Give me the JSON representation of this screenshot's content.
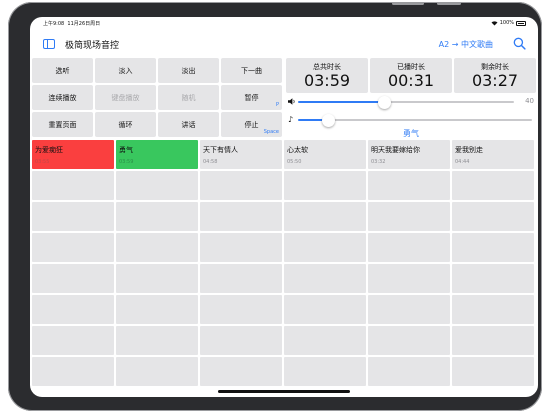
{
  "status": {
    "time": "上午9:08",
    "date": "11月26日周日",
    "battery": "100%"
  },
  "header": {
    "title": "极简现场音控",
    "playlist": "A2 → 中文歌曲"
  },
  "controls": [
    {
      "label": "选听"
    },
    {
      "label": "淡入"
    },
    {
      "label": "淡出"
    },
    {
      "label": "下一曲"
    },
    {
      "label": "连续播放"
    },
    {
      "label": "键盘播放",
      "disabled": true
    },
    {
      "label": "随机",
      "disabled": true
    },
    {
      "label": "暂停",
      "hotkey": "P"
    },
    {
      "label": "重置页面"
    },
    {
      "label": "循环"
    },
    {
      "label": "讲话"
    },
    {
      "label": "停止",
      "hotkey": "Space"
    }
  ],
  "timers": [
    {
      "label": "总共时长",
      "value": "03:59"
    },
    {
      "label": "已播时长",
      "value": "00:31"
    },
    {
      "label": "剩余时长",
      "value": "03:27"
    }
  ],
  "volume": {
    "value": "40",
    "level": 0.4
  },
  "progress": {
    "fraction": 0.13
  },
  "now_playing": "勇气",
  "tracks": [
    {
      "title": "为爱痴狂",
      "duration": "03:55",
      "state": "red"
    },
    {
      "title": "勇气",
      "duration": "03:59",
      "state": "green"
    },
    {
      "title": "天下有情人",
      "duration": "04:58"
    },
    {
      "title": "心太软",
      "duration": "05:50"
    },
    {
      "title": "明天我要嫁给你",
      "duration": "03:32"
    },
    {
      "title": "爱我别走",
      "duration": "04:44"
    }
  ],
  "colors": {
    "accent": "#2f7bf5",
    "playing": "#39c75e",
    "played": "#fa3f3f",
    "button_bg": "#e5e5e7"
  }
}
